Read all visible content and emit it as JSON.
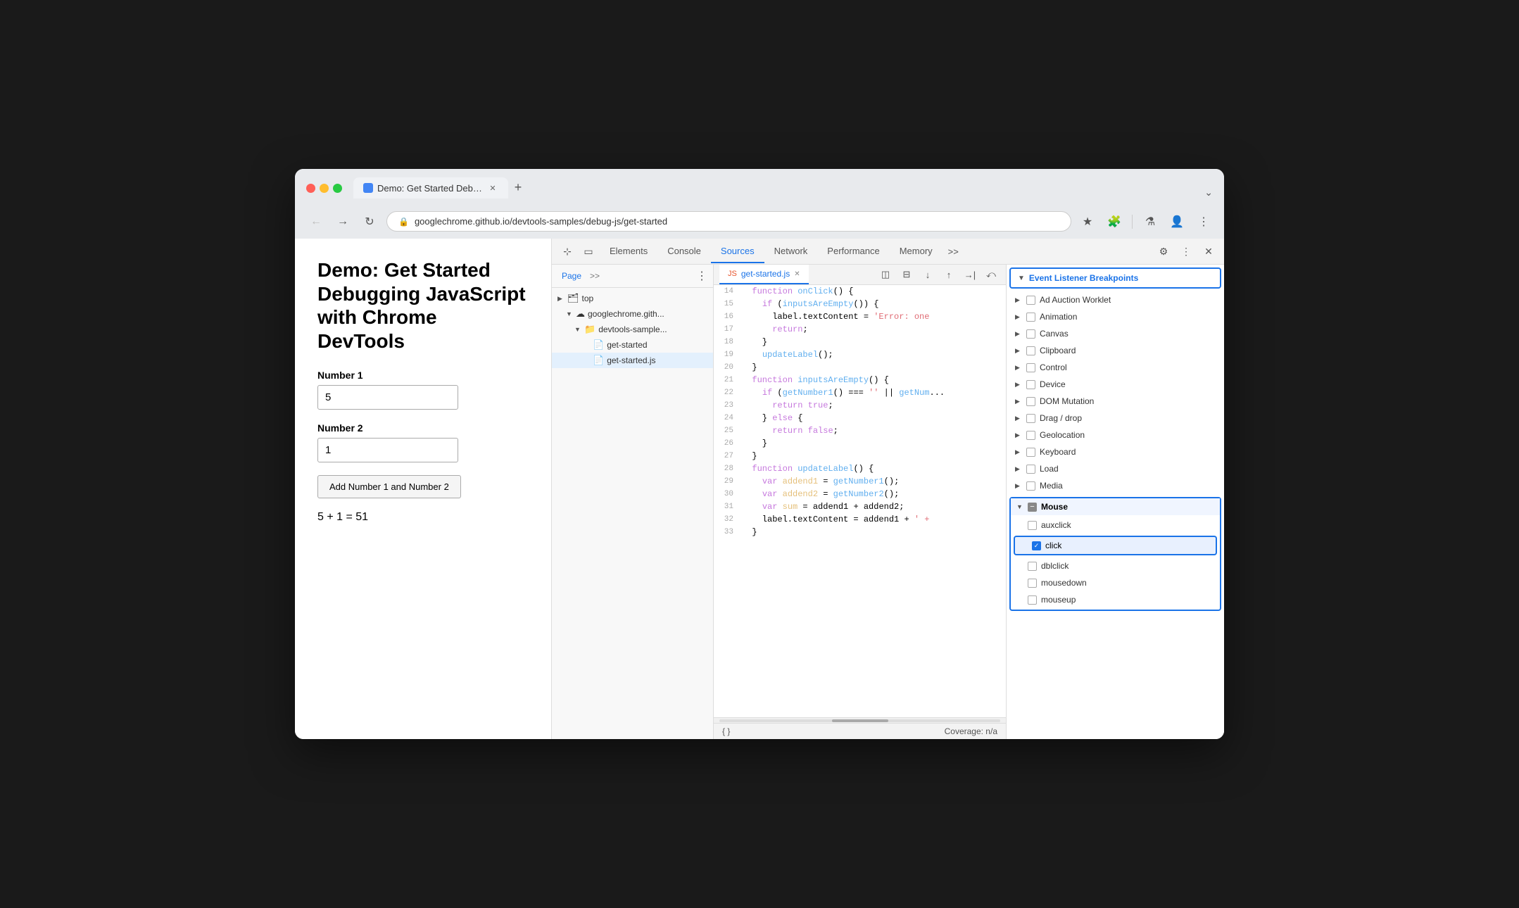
{
  "browser": {
    "tab_title": "Demo: Get Started Debuggin...",
    "url": "googlechrome.github.io/devtools-samples/debug-js/get-started",
    "new_tab_label": "+",
    "chevron_down": "⌄"
  },
  "page": {
    "title": "Demo: Get Started Debugging JavaScript with Chrome DevTools",
    "number1_label": "Number 1",
    "number1_value": "5",
    "number2_label": "Number 2",
    "number2_value": "1",
    "add_button_label": "Add Number 1 and Number 2",
    "result_text": "5 + 1 = 51"
  },
  "devtools": {
    "tabs": [
      "Elements",
      "Console",
      "Sources",
      "Network",
      "Performance",
      "Memory"
    ],
    "active_tab": "Sources",
    "more_tabs": ">>",
    "file_tree": {
      "tab_page": "Page",
      "tab_more": ">>",
      "items": [
        {
          "label": "top",
          "type": "folder",
          "arrow": "▶",
          "indent": 0
        },
        {
          "label": "googlechrome.gith...",
          "type": "cloud",
          "arrow": "▼",
          "indent": 1
        },
        {
          "label": "devtools-sample...",
          "type": "folder-blue",
          "arrow": "▼",
          "indent": 2
        },
        {
          "label": "get-started",
          "type": "file",
          "arrow": "",
          "indent": 3
        },
        {
          "label": "get-started.js",
          "type": "file-orange",
          "arrow": "",
          "indent": 3
        }
      ]
    },
    "code_tab": "get-started.js",
    "code_lines": [
      {
        "num": 14,
        "content": "  function onClick() {"
      },
      {
        "num": 15,
        "content": "    if (inputsAreEmpty()) {"
      },
      {
        "num": 16,
        "content": "      label.textContent = 'Error: one"
      },
      {
        "num": 17,
        "content": "      return;"
      },
      {
        "num": 18,
        "content": "    }"
      },
      {
        "num": 19,
        "content": "    updateLabel();"
      },
      {
        "num": 20,
        "content": "  }"
      },
      {
        "num": 21,
        "content": "  function inputsAreEmpty() {"
      },
      {
        "num": 22,
        "content": "    if (getNumber1() === '' || getNum..."
      },
      {
        "num": 23,
        "content": "      return true;"
      },
      {
        "num": 24,
        "content": "    } else {"
      },
      {
        "num": 25,
        "content": "      return false;"
      },
      {
        "num": 26,
        "content": "    }"
      },
      {
        "num": 27,
        "content": "  }"
      },
      {
        "num": 28,
        "content": "  function updateLabel() {"
      },
      {
        "num": 29,
        "content": "    var addend1 = getNumber1();"
      },
      {
        "num": 30,
        "content": "    var addend2 = getNumber2();"
      },
      {
        "num": 31,
        "content": "    var sum = addend1 + addend2;"
      },
      {
        "num": 32,
        "content": "    label.textContent = addend1 + ' +"
      },
      {
        "num": 33,
        "content": "  }"
      }
    ],
    "code_footer_left": "{ }",
    "code_footer_right": "Coverage: n/a"
  },
  "breakpoints": {
    "panel_title": "Event Listener Breakpoints",
    "items": [
      {
        "label": "Ad Auction Worklet",
        "arrow": "▶",
        "checked": false
      },
      {
        "label": "Animation",
        "arrow": "▶",
        "checked": false
      },
      {
        "label": "Canvas",
        "arrow": "▶",
        "checked": false
      },
      {
        "label": "Clipboard",
        "arrow": "▶",
        "checked": false
      },
      {
        "label": "Control",
        "arrow": "▶",
        "checked": false
      },
      {
        "label": "Device",
        "arrow": "▶",
        "checked": false
      },
      {
        "label": "DOM Mutation",
        "arrow": "▶",
        "checked": false
      },
      {
        "label": "Drag / drop",
        "arrow": "▶",
        "checked": false
      },
      {
        "label": "Geolocation",
        "arrow": "▶",
        "checked": false
      },
      {
        "label": "Keyboard",
        "arrow": "▶",
        "checked": false
      },
      {
        "label": "Load",
        "arrow": "▶",
        "checked": false
      },
      {
        "label": "Media",
        "arrow": "▶",
        "checked": false
      }
    ],
    "mouse_section": {
      "label": "Mouse",
      "expanded": true,
      "sub_items": [
        {
          "label": "auxclick",
          "checked": false
        },
        {
          "label": "click",
          "checked": true
        },
        {
          "label": "dblclick",
          "checked": false
        },
        {
          "label": "mousedown",
          "checked": false
        },
        {
          "label": "mouseup",
          "checked": false
        }
      ]
    }
  }
}
